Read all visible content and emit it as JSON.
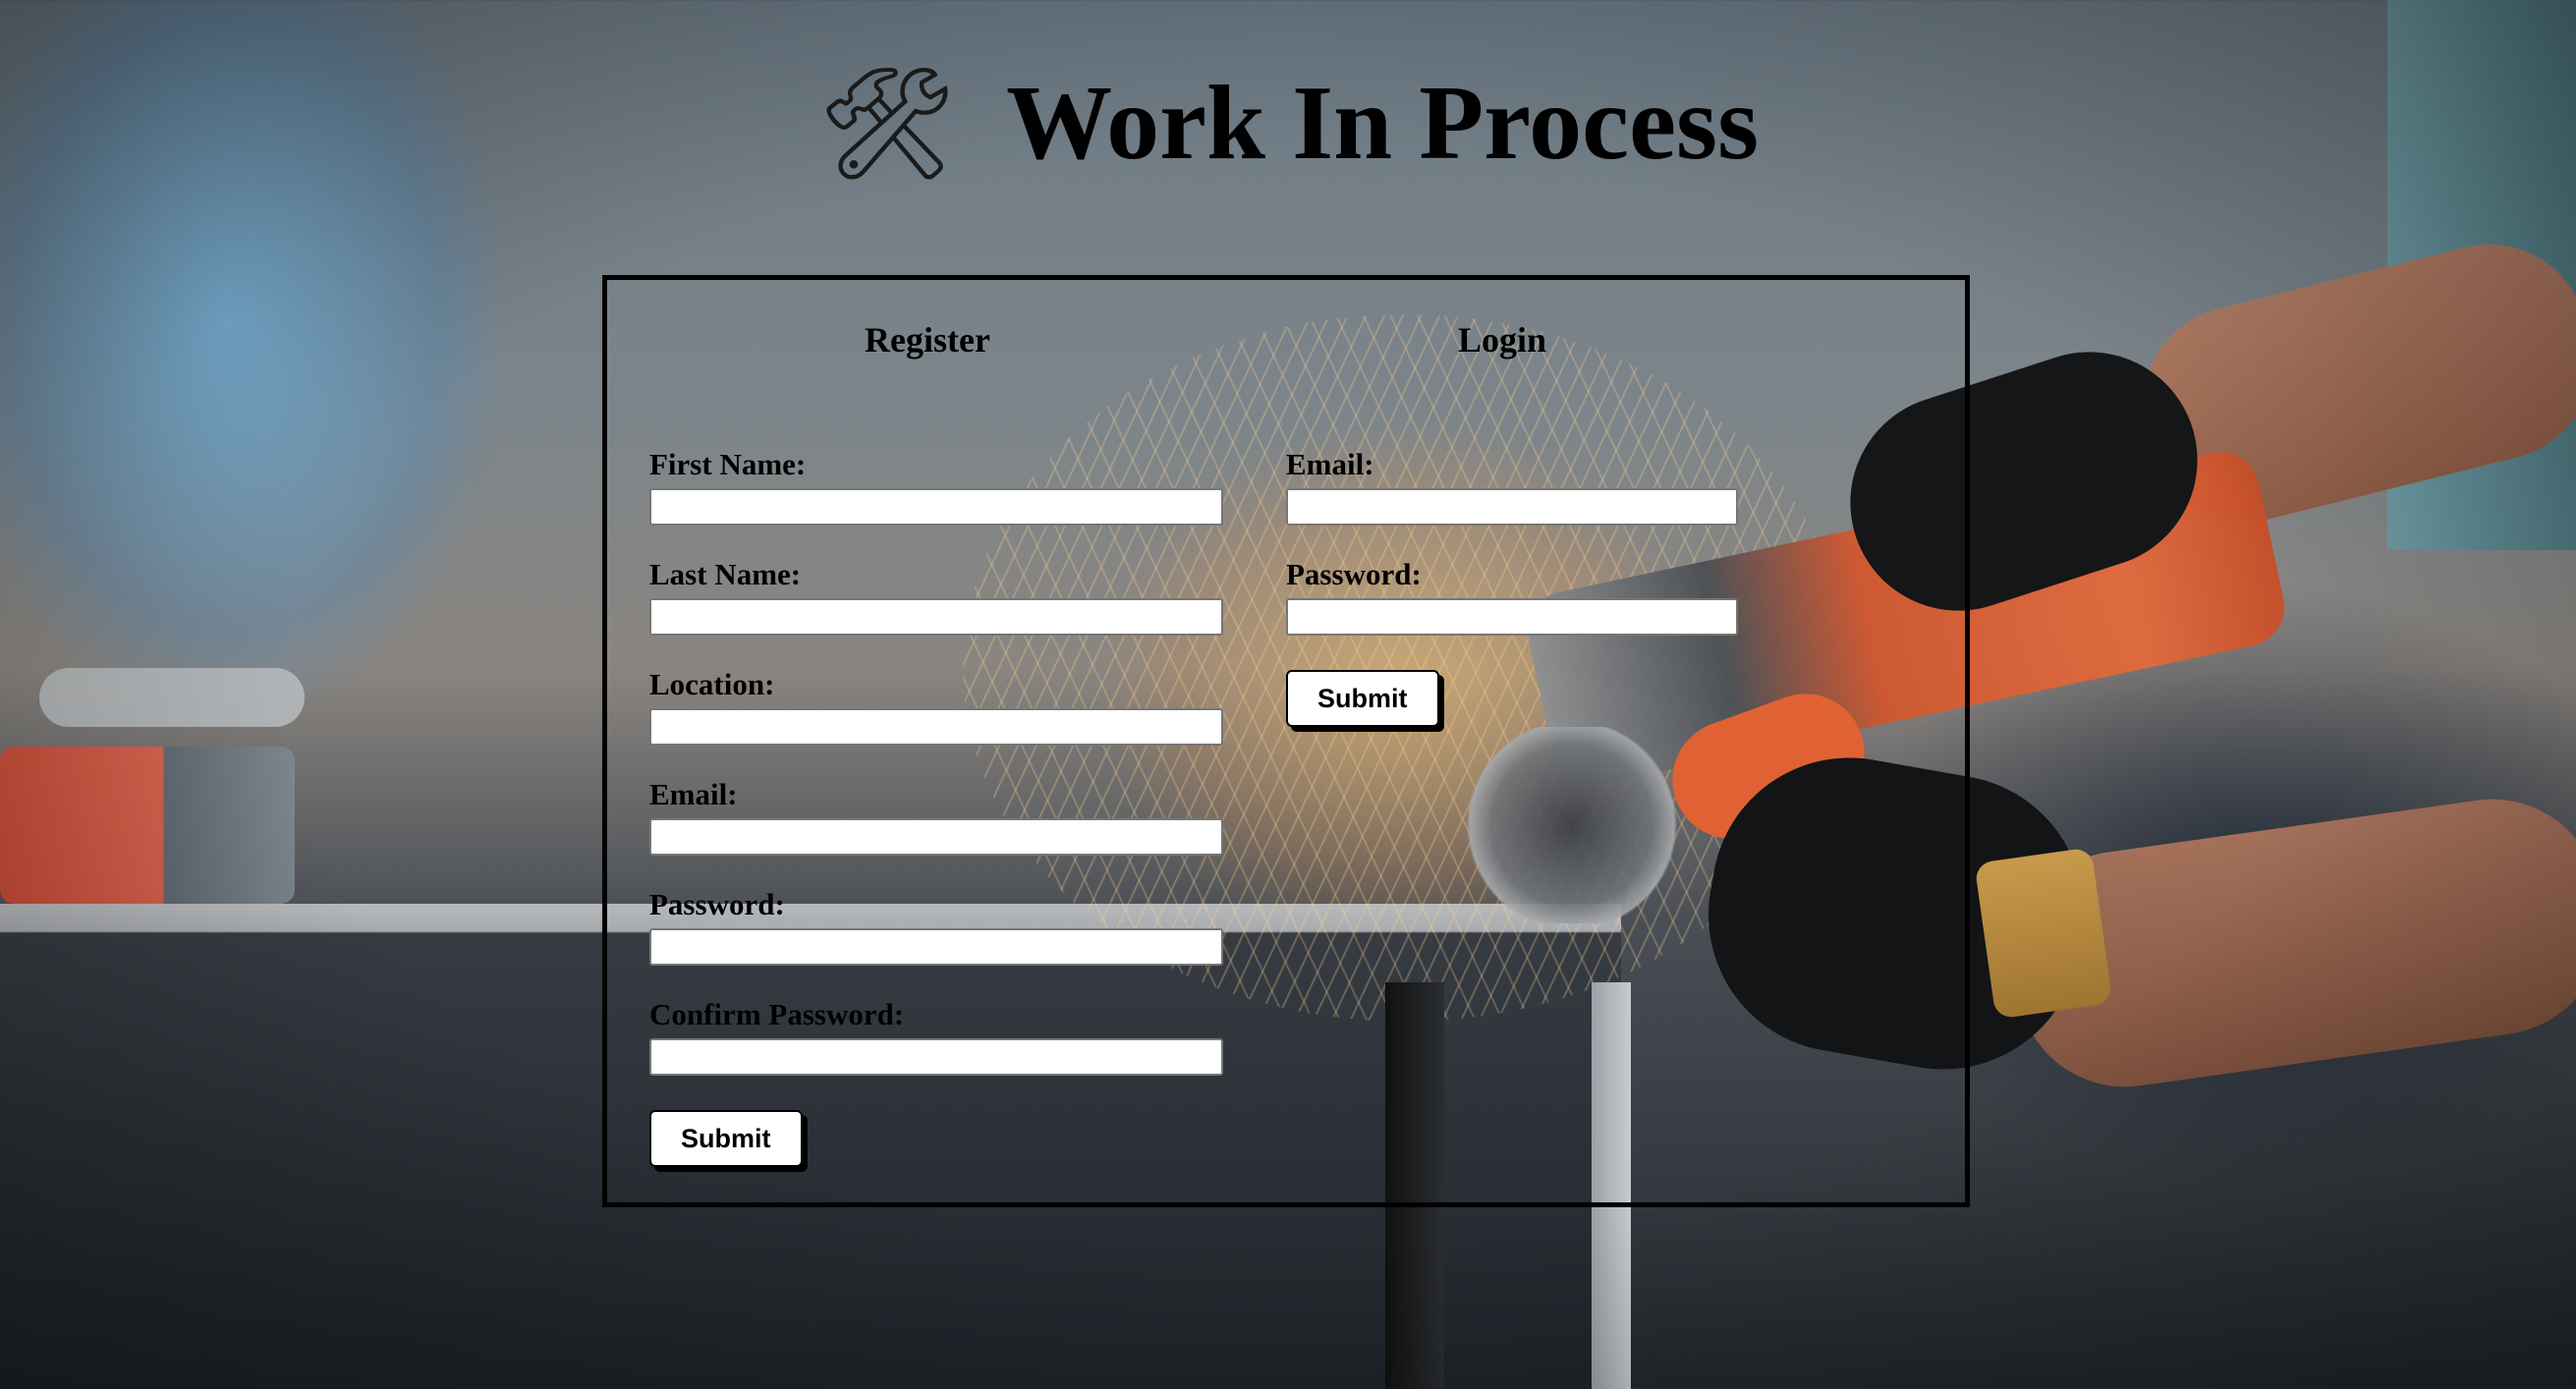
{
  "header": {
    "icon": "🛠",
    "title": "Work In Process"
  },
  "register": {
    "heading": "Register",
    "fields": [
      {
        "label": "First Name:",
        "value": ""
      },
      {
        "label": "Last Name:",
        "value": ""
      },
      {
        "label": "Location:",
        "value": ""
      },
      {
        "label": "Email:",
        "value": ""
      },
      {
        "label": "Password:",
        "value": ""
      },
      {
        "label": "Confirm Password:",
        "value": ""
      }
    ],
    "submit_label": "Submit"
  },
  "login": {
    "heading": "Login",
    "fields": [
      {
        "label": "Email:",
        "value": ""
      },
      {
        "label": "Password:",
        "value": ""
      }
    ],
    "submit_label": "Submit"
  }
}
